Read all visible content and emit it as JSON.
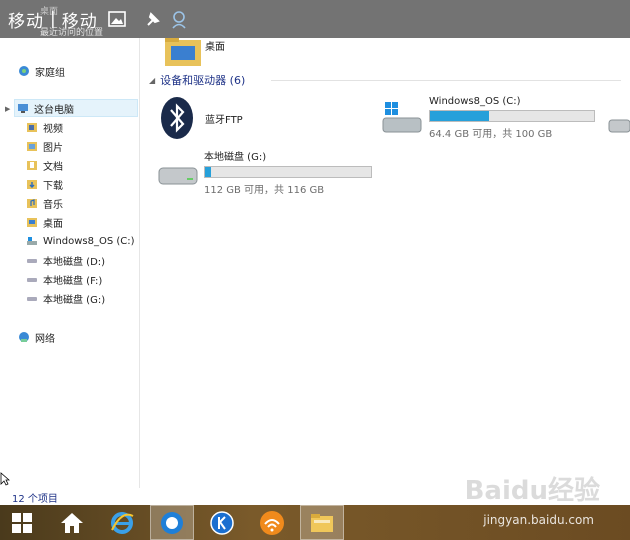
{
  "topbar": {
    "title_left": "移动",
    "title_right": "移动",
    "ghost_top": "桌面",
    "ghost_sub": "最近访问的位置"
  },
  "nav": {
    "homegroup": "家庭组",
    "this_pc": "这台电脑",
    "items": [
      "视频",
      "图片",
      "文档",
      "下载",
      "音乐",
      "桌面",
      "Windows8_OS (C:)",
      "本地磁盘 (D:)",
      "本地磁盘 (F:)",
      "本地磁盘 (G:)"
    ],
    "network": "网络"
  },
  "content": {
    "desktop_label": "桌面",
    "group_header": "设备和驱动器 (6)",
    "bluetooth": "蓝牙FTP",
    "drive_c": {
      "name": "Windows8_OS (C:)",
      "free": "64.4 GB 可用，共 100 GB",
      "used_fraction": 0.36
    },
    "drive_g": {
      "name": "本地磁盘 (G:)",
      "free": "112 GB 可用，共 116 GB",
      "used_fraction": 0.035
    }
  },
  "status": {
    "count": "12 个项目"
  },
  "watermark": {
    "site": "jingyan.baidu.com",
    "logo": "Baidu经验"
  },
  "colors": {
    "accent": "#26a0da",
    "header_text": "#1e3287"
  }
}
